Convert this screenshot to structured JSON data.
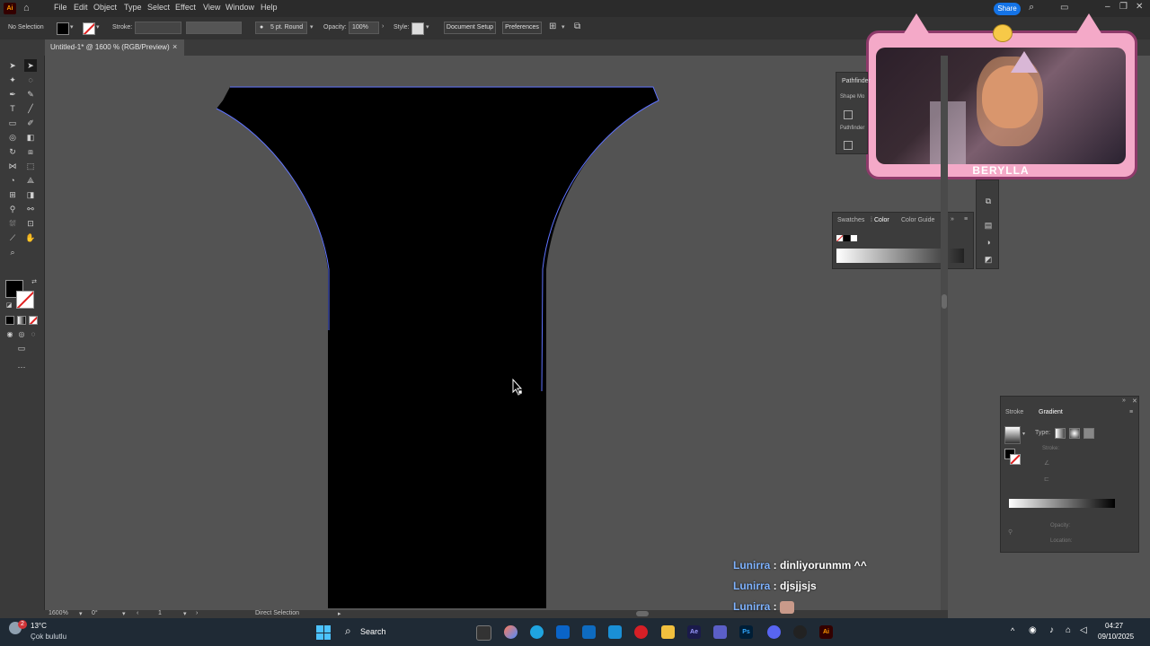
{
  "app": {
    "logo": "Ai",
    "menu": [
      "File",
      "Edit",
      "Object",
      "Type",
      "Select",
      "Effect",
      "View",
      "Window",
      "Help"
    ],
    "share_label": "Share"
  },
  "controlbar": {
    "selection_status": "No Selection",
    "stroke_label": "Stroke:",
    "brush_value": "5 pt. Round",
    "opacity_label": "Opacity:",
    "opacity_value": "100%",
    "style_label": "Style:",
    "document_setup": "Document Setup",
    "preferences": "Preferences"
  },
  "document": {
    "tab_title": "Untitled-1* @ 1600 % (RGB/Preview)",
    "close_icon": "×"
  },
  "panels": {
    "pathfinder_title": "Pathfinder",
    "shape_modes": "Shape Mo",
    "pathfinders": "Pathfinder",
    "color_tabs": [
      "Swatches",
      "Color",
      "Color Guide"
    ],
    "color_active": "Color",
    "gradient_tabs": [
      "Stroke",
      "Gradient"
    ],
    "gradient_active": "Gradient",
    "gradient_type_label": "Type:",
    "gradient_stroke_label": "Stroke:",
    "gradient_opacity_label": "Opacity:",
    "gradient_location_label": "Location:"
  },
  "statusbar": {
    "zoom": "1600%",
    "rotation": "0°",
    "artboard": "1",
    "tool": "Direct Selection"
  },
  "webcam": {
    "name": "BERYLLA"
  },
  "chat": [
    {
      "user": "Lunirra",
      "message": "dinliyorunmm ^^"
    },
    {
      "user": "Lunirra",
      "message": "djsjjsjs"
    },
    {
      "user": "Lunirra",
      "message": ""
    }
  ],
  "taskbar": {
    "weather_temp": "13°C",
    "weather_desc": "Çok bulutlu",
    "notification_count": "2",
    "search_label": "Search",
    "time": "04:27",
    "date": "09/10/2025"
  },
  "colors": {
    "accent": "#1473e6",
    "chat_user": "#7fb3ff",
    "taskbar": "#1f2a35"
  }
}
